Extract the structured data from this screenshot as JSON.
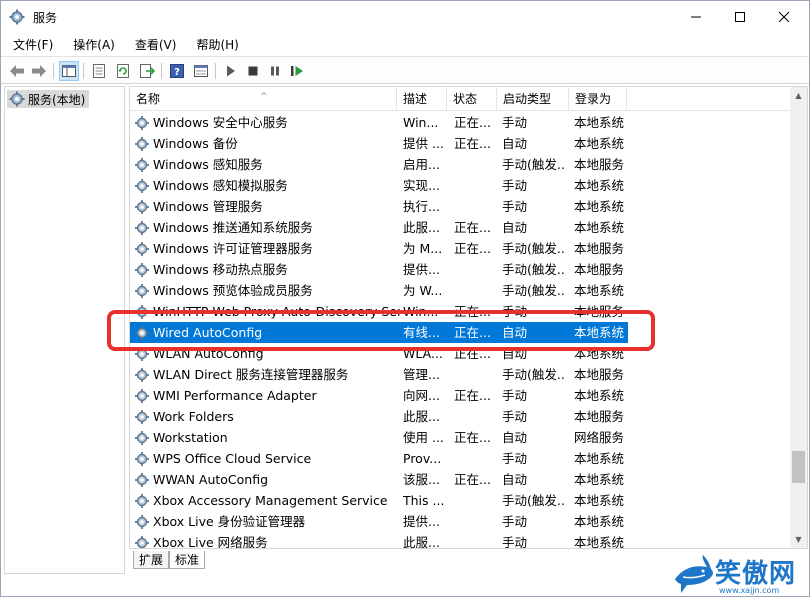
{
  "window": {
    "title": "服务",
    "icon": "services-gear-icon"
  },
  "menu": [
    "文件(F)",
    "操作(A)",
    "查看(V)",
    "帮助(H)"
  ],
  "toolbar": {
    "icons": [
      "back-arrow-icon",
      "forward-arrow-icon",
      "console-tree-icon",
      "properties-icon",
      "refresh-icon",
      "export-icon",
      "help-icon",
      "view-icon",
      "play-icon",
      "stop-icon",
      "pause-icon",
      "restart-icon"
    ]
  },
  "tree": {
    "root": "服务(本地)"
  },
  "columns": [
    "名称",
    "描述",
    "状态",
    "启动类型",
    "登录为"
  ],
  "services": [
    {
      "name": "Windows 安全中心服务",
      "desc": "Win...",
      "status": "正在...",
      "start": "手动",
      "logon": "本地系统"
    },
    {
      "name": "Windows 备份",
      "desc": "提供 ...",
      "status": "正在...",
      "start": "自动",
      "logon": "本地系统"
    },
    {
      "name": "Windows 感知服务",
      "desc": "启用...",
      "status": "",
      "start": "手动(触发...",
      "logon": "本地服务"
    },
    {
      "name": "Windows 感知模拟服务",
      "desc": "实现...",
      "status": "",
      "start": "手动",
      "logon": "本地系统"
    },
    {
      "name": "Windows 管理服务",
      "desc": "执行...",
      "status": "",
      "start": "手动",
      "logon": "本地系统"
    },
    {
      "name": "Windows 推送通知系统服务",
      "desc": "此服...",
      "status": "正在...",
      "start": "自动",
      "logon": "本地系统"
    },
    {
      "name": "Windows 许可证管理器服务",
      "desc": "为 M...",
      "status": "正在...",
      "start": "手动(触发...",
      "logon": "本地服务"
    },
    {
      "name": "Windows 移动热点服务",
      "desc": "提供...",
      "status": "",
      "start": "手动(触发...",
      "logon": "本地服务"
    },
    {
      "name": "Windows 预览体验成员服务",
      "desc": "为 W...",
      "status": "",
      "start": "手动(触发...",
      "logon": "本地系统"
    },
    {
      "name": "WinHTTP Web Proxy Auto-Discovery Service",
      "desc": "Win...",
      "status": "正在...",
      "start": "手动",
      "logon": "本地服务"
    },
    {
      "name": "Wired AutoConfig",
      "desc": "有线...",
      "status": "正在...",
      "start": "自动",
      "logon": "本地系统"
    },
    {
      "name": "WLAN AutoConfig",
      "desc": "WLA...",
      "status": "正在...",
      "start": "自动",
      "logon": "本地系统"
    },
    {
      "name": "WLAN Direct 服务连接管理器服务",
      "desc": "管理...",
      "status": "",
      "start": "手动(触发...",
      "logon": "本地服务"
    },
    {
      "name": "WMI Performance Adapter",
      "desc": "向网...",
      "status": "正在...",
      "start": "手动",
      "logon": "本地系统"
    },
    {
      "name": "Work Folders",
      "desc": "此服...",
      "status": "",
      "start": "手动",
      "logon": "本地服务"
    },
    {
      "name": "Workstation",
      "desc": "使用 ...",
      "status": "正在...",
      "start": "自动",
      "logon": "网络服务"
    },
    {
      "name": "WPS Office Cloud Service",
      "desc": "Prov...",
      "status": "",
      "start": "手动",
      "logon": "本地系统"
    },
    {
      "name": "WWAN AutoConfig",
      "desc": "该服...",
      "status": "正在...",
      "start": "自动",
      "logon": "本地系统"
    },
    {
      "name": "Xbox Accessory Management Service",
      "desc": "This ...",
      "status": "",
      "start": "手动(触发...",
      "logon": "本地系统"
    },
    {
      "name": "Xbox Live 身份验证管理器",
      "desc": "提供...",
      "status": "",
      "start": "手动",
      "logon": "本地系统"
    },
    {
      "name": "Xbox Live 网络服务",
      "desc": "此服...",
      "status": "",
      "start": "手动",
      "logon": "本地系统"
    }
  ],
  "selected_index": 10,
  "tabs": [
    "扩展",
    "标准"
  ],
  "watermark": {
    "text": "笑傲网",
    "url": "www.xajjn.com"
  },
  "colors": {
    "selection": "#0078d7",
    "highlight_box": "#e8312d",
    "watermark": "#1e76c8"
  }
}
